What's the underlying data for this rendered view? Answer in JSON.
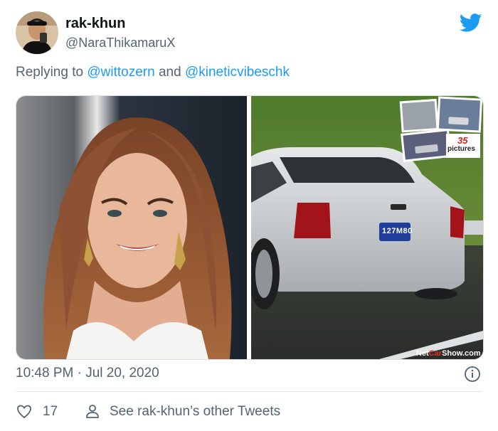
{
  "author": {
    "name": "rak-khun",
    "handle": "@NaraThikamaruX"
  },
  "reply": {
    "prefix": "Replying to",
    "mention1": "@wittozern",
    "joiner": "and",
    "mention2": "@kineticvibeschk"
  },
  "media": {
    "right_watermark": {
      "brand_a": "Net",
      "brand_b": "Car",
      "brand_c": "Show.com",
      "pictures_count": "35",
      "pictures_label": "pictures",
      "plate": "127M80"
    }
  },
  "meta": {
    "time": "10:48 PM",
    "sep": "·",
    "date": "Jul 20, 2020"
  },
  "actions": {
    "likes": "17",
    "other_tweets": "See rak-khun’s other Tweets"
  },
  "colors": {
    "accent": "#1d9bf0",
    "muted": "#536471"
  },
  "icons": [
    "twitter-bird-icon",
    "info-icon",
    "heart-icon",
    "person-icon"
  ]
}
